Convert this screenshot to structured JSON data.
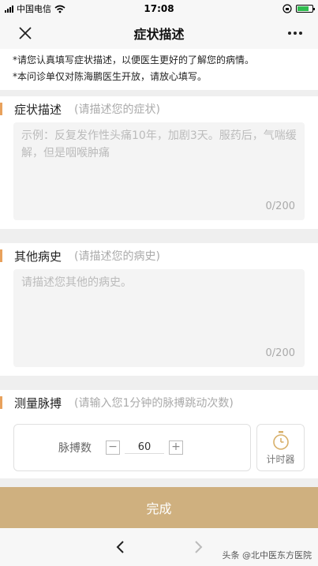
{
  "status_bar": {
    "carrier": "中国电信",
    "time": "17:08",
    "icons": [
      "signal-icon",
      "wifi-icon",
      "rotation-lock-icon",
      "battery-icon"
    ],
    "battery_color": "#2fbd4f"
  },
  "nav": {
    "title": "症状描述",
    "close_icon": "close-icon",
    "more_icon": "more-icon"
  },
  "notice": {
    "line1": "*请您认真填写症状描述，以便医生更好的了解您的病情。",
    "line2": "*本问诊单仅对陈海鹏医生开放，请放心填写。"
  },
  "symptom": {
    "title": "症状描述",
    "hint": "(请描述您的症状)",
    "placeholder": "示例：反复发作性头痛10年，加剧3天。服药后，气喘缓解，但是咽喉肿痛",
    "counter": "0/200"
  },
  "history": {
    "title": "其他病史",
    "hint": "(请描述您的病史)",
    "placeholder": "请描述您其他的病史。",
    "counter": "0/200"
  },
  "pulse": {
    "title": "测量脉搏",
    "hint": "(请输入您1分钟的脉搏跳动次数)",
    "label": "脉搏数",
    "minus": "−",
    "value": "60",
    "plus": "+",
    "timer_label": "计时器",
    "timer_icon": "stopwatch-icon"
  },
  "footer": {
    "done_label": "完成",
    "back_icon": "back-arrow-icon",
    "forward_icon": "forward-arrow-icon",
    "watermark": "头条 @北中医东方医院"
  },
  "colors": {
    "accent": "#e8a15c",
    "done_button": "#cfb07f",
    "background": "#efefef"
  }
}
